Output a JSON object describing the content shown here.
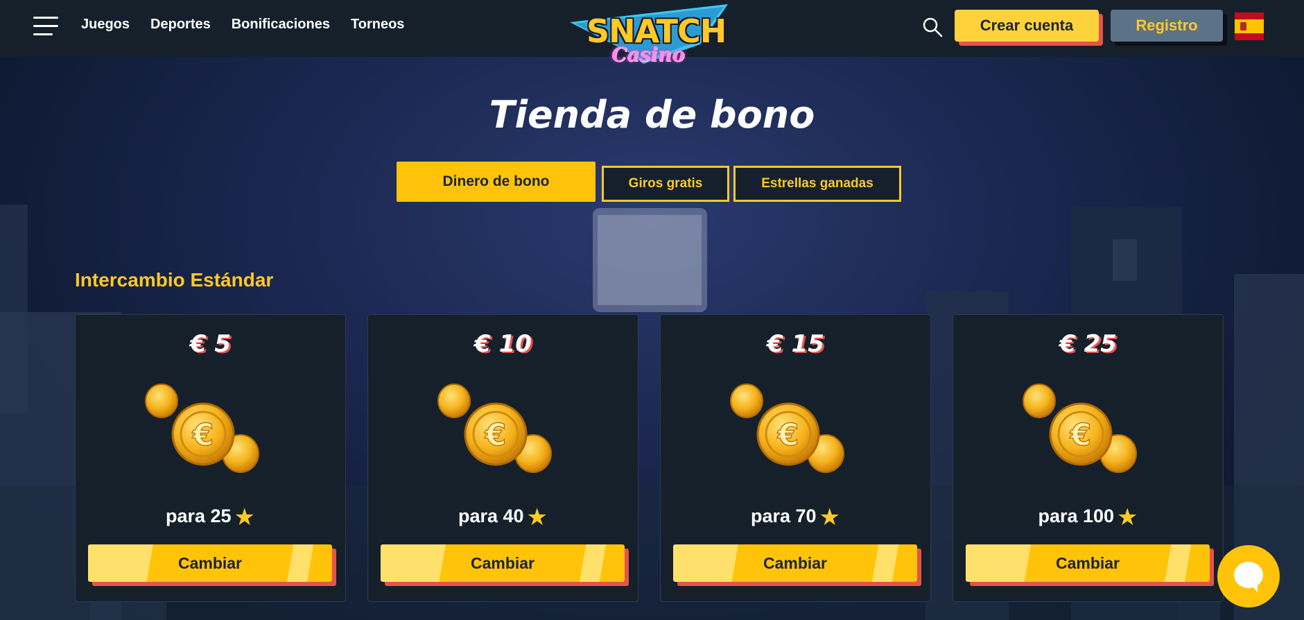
{
  "header": {
    "menu_icon": "hamburger-menu-icon",
    "nav": [
      "Juegos",
      "Deportes",
      "Bonificaciones",
      "Torneos"
    ],
    "logo": {
      "word": "SNATCH",
      "sub": "Casino"
    },
    "search_icon": "search-icon",
    "create_account": "Crear cuenta",
    "register": "Registro",
    "language_flag": "spain-flag-icon"
  },
  "page": {
    "title": "Tienda de bono",
    "tabs": [
      {
        "label": "Dinero de bono",
        "active": true
      },
      {
        "label": "Giros gratis",
        "active": false
      },
      {
        "label": "Estrellas ganadas",
        "active": false
      }
    ],
    "section_title": "Intercambio Estándar"
  },
  "cards": [
    {
      "amount": "€ 5",
      "cost": "para 25",
      "button": "Cambiar"
    },
    {
      "amount": "€ 10",
      "cost": "para 40",
      "button": "Cambiar"
    },
    {
      "amount": "€ 15",
      "cost": "para 70",
      "button": "Cambiar"
    },
    {
      "amount": "€ 25",
      "cost": "para 100",
      "button": "Cambiar"
    }
  ],
  "icons": {
    "coin": "coins-icon",
    "star": "star-icon",
    "chat": "chat-icon"
  },
  "colors": {
    "accent": "#ffc30a",
    "header_bg": "#15202b",
    "shadow_red": "#e5544b",
    "register_bg": "#5c7287"
  }
}
